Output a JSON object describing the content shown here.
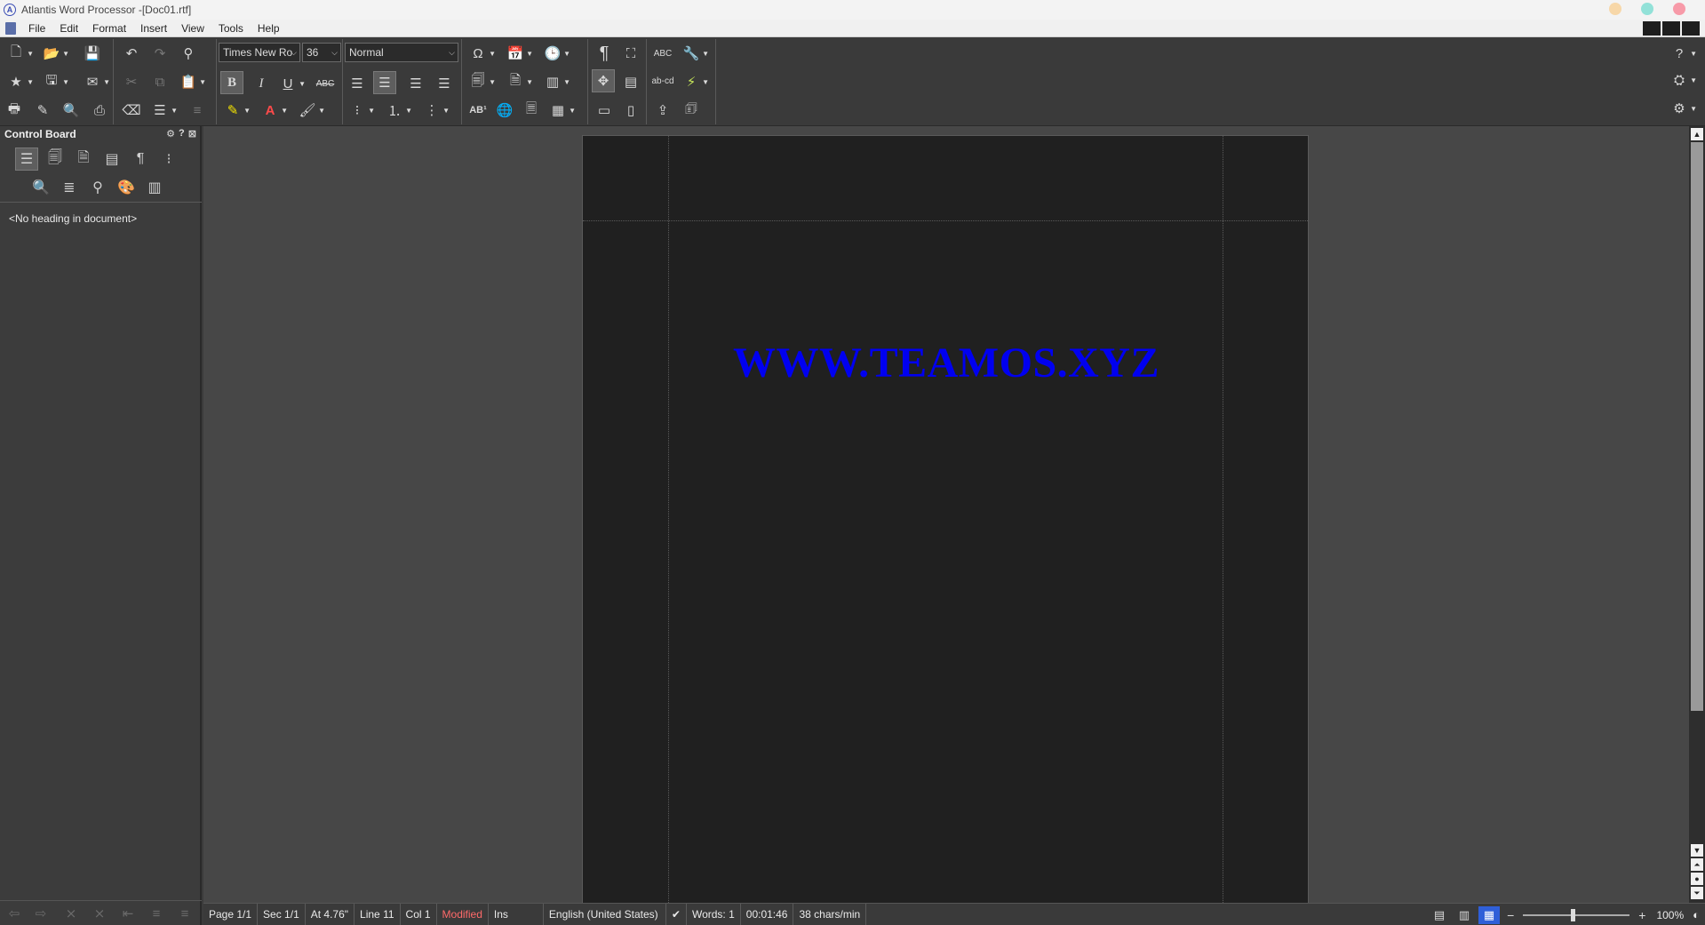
{
  "window": {
    "title": "Atlantis Word Processor -[Doc01.rtf]",
    "app_icon_glyph": "A",
    "controls": [
      {
        "name": "minimize-dot",
        "color": "#f7d7a8"
      },
      {
        "name": "maximize-dot",
        "color": "#92e1d8"
      },
      {
        "name": "close-dot",
        "color": "#f79aa8"
      }
    ]
  },
  "menu": {
    "items": [
      "File",
      "Edit",
      "Format",
      "Insert",
      "View",
      "Tools",
      "Help"
    ]
  },
  "toolbar": {
    "font_name": "Times New Ro",
    "font_size": "36",
    "style": "Normal",
    "bold_glyph": "B",
    "italic_glyph": "I",
    "underline_glyph": "U",
    "strike_glyph": "ABC",
    "hyphen_glyph": "ab-cd",
    "spell_glyph": "ABC",
    "superscript_glyph": "AB¹"
  },
  "control_board": {
    "title": "Control Board",
    "empty_message": "<No heading in document>"
  },
  "document": {
    "text": "WWW.TEAMOS.XYZ",
    "text_color": "#0000f0",
    "page_background": "#202020"
  },
  "status": {
    "page": "Page 1/1",
    "section": "Sec 1/1",
    "position": "At 4.76\"",
    "line": "Line 11",
    "col": "Col 1",
    "modified": "Modified",
    "insert_mode": "Ins",
    "language": "English (United States)",
    "words": "Words: 1",
    "time": "00:01:46",
    "speed": "38 chars/min",
    "zoom": "100%",
    "zoom_level_fraction": 0.47
  }
}
